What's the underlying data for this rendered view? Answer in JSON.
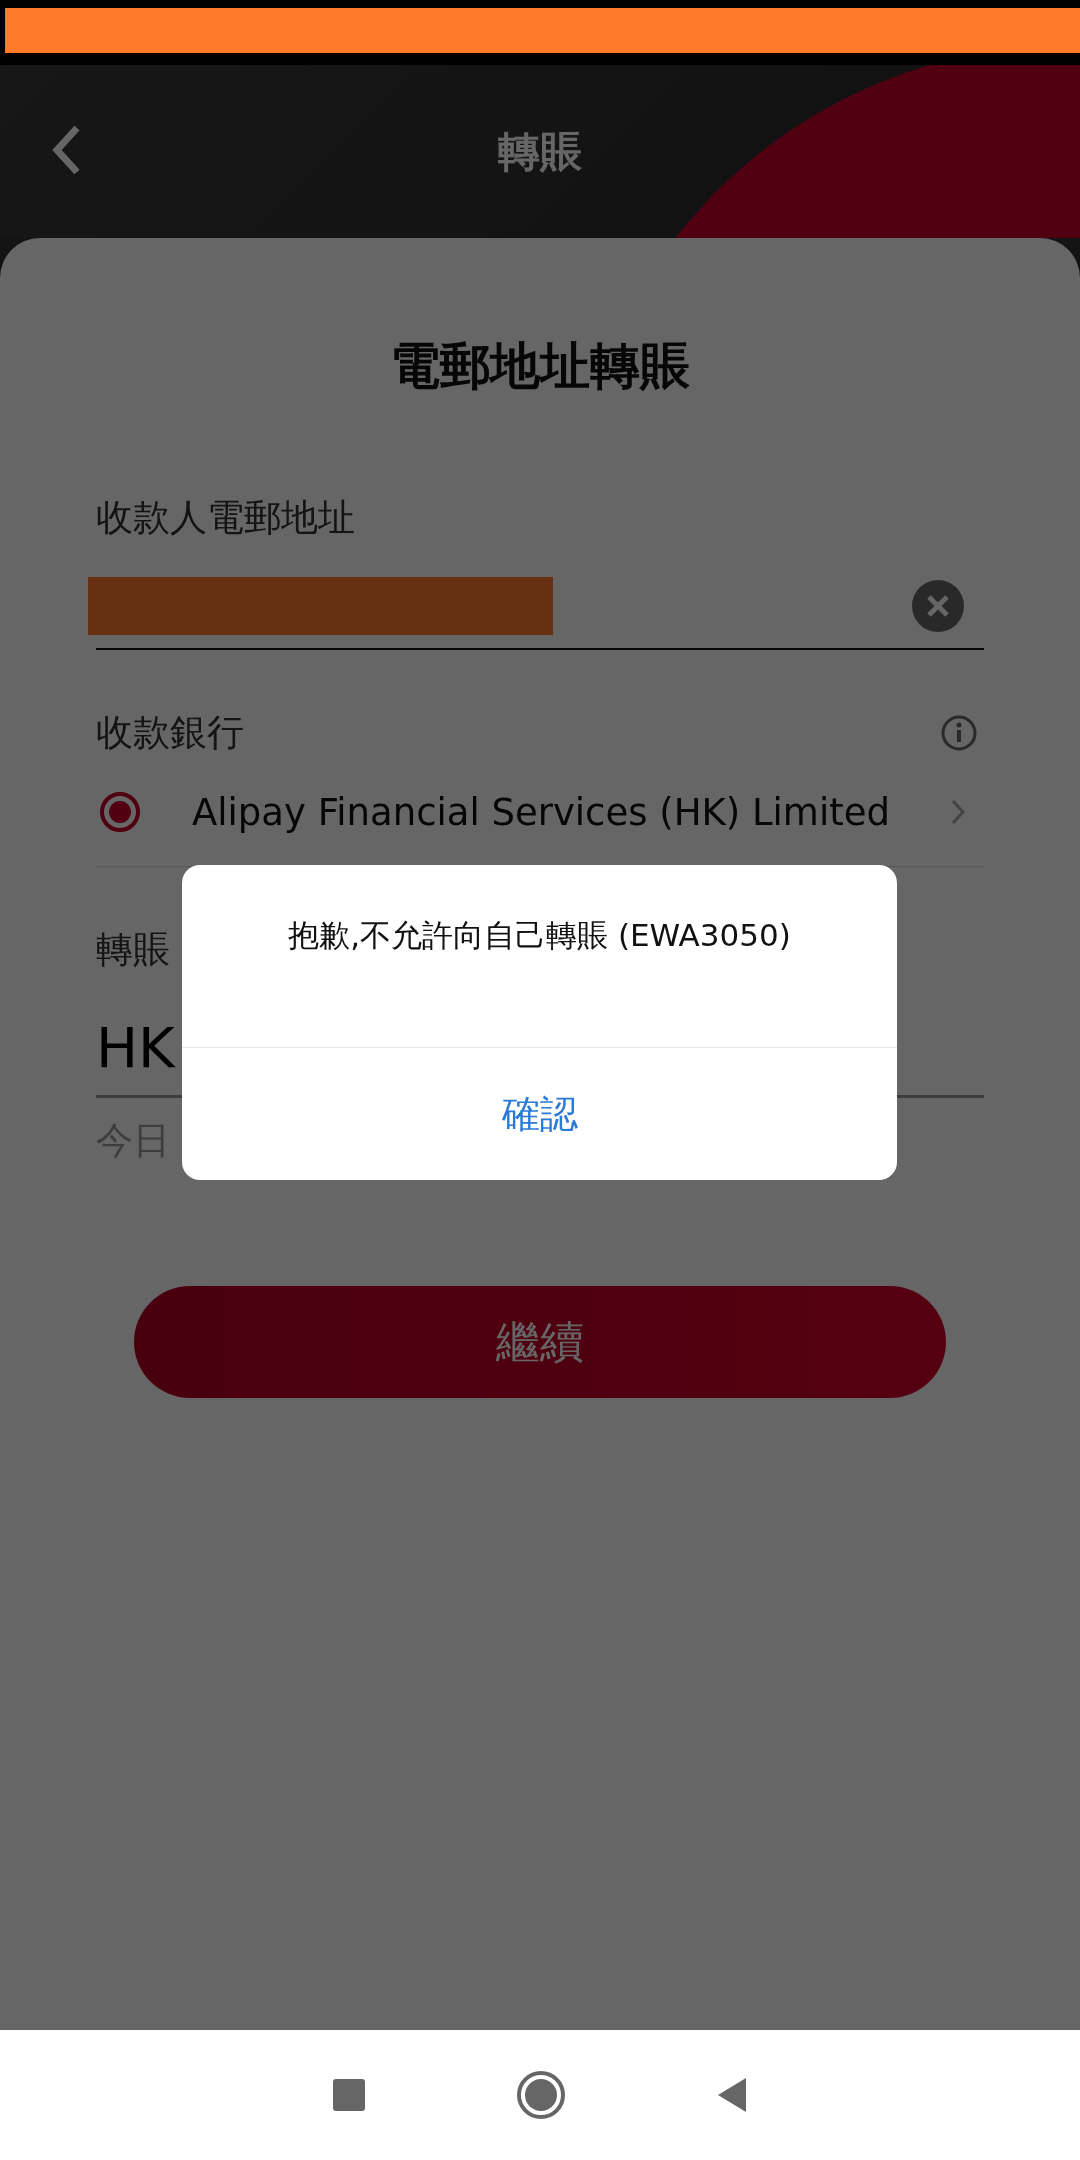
{
  "header": {
    "title": "轉賬"
  },
  "form": {
    "title": "電郵地址轉賬",
    "recipient_email": {
      "label": "收款人電郵地址"
    },
    "bank": {
      "label": "收款銀行",
      "options": [
        {
          "name": "Alipay Financial Services (HK) Limited",
          "selected": true
        }
      ]
    },
    "amount": {
      "label": "轉賬",
      "currency": "HK",
      "note": "今日"
    },
    "continue_button": "繼續"
  },
  "dialog": {
    "message": "抱歉,不允許向自己轉賬 (EWA3050)",
    "confirm": "確認"
  }
}
